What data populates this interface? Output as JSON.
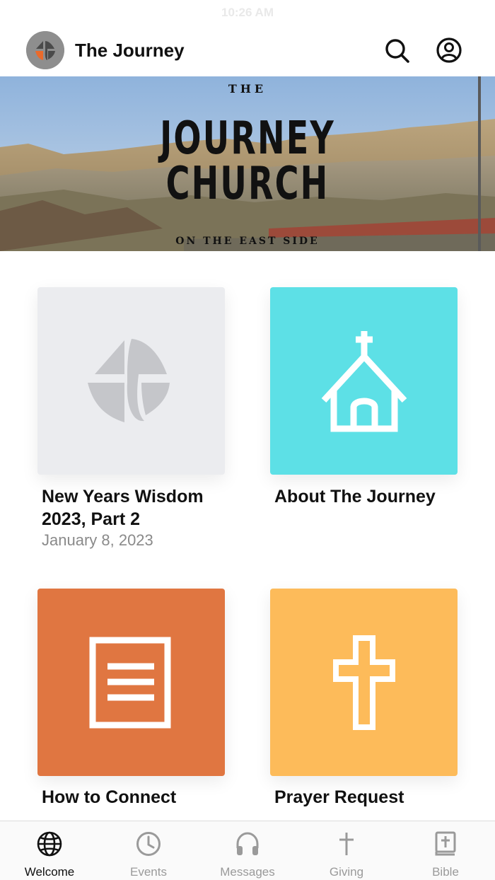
{
  "status": {
    "time": "10:26 AM"
  },
  "header": {
    "title": "The Journey"
  },
  "hero": {
    "line_top": "THE",
    "line_main_1": "JOURNEY",
    "line_main_2": "CHURCH",
    "line_bottom": "ON THE EAST SIDE"
  },
  "tiles": [
    {
      "title": "New Years Wisdom 2023, Part 2",
      "date": "January 8, 2023",
      "icon": "church-logo-icon",
      "color": "#ebecef"
    },
    {
      "title": "About The Journey",
      "icon": "chapel-icon",
      "color": "#5de0e6"
    },
    {
      "title": "How to Connect",
      "icon": "document-icon",
      "color": "#e07641"
    },
    {
      "title": "Prayer Request",
      "icon": "cross-icon",
      "color": "#fdbb5a"
    }
  ],
  "tabs": [
    {
      "label": "Welcome",
      "icon": "globe-icon",
      "active": true
    },
    {
      "label": "Events",
      "icon": "clock-icon",
      "active": false
    },
    {
      "label": "Messages",
      "icon": "headphones-icon",
      "active": false
    },
    {
      "label": "Giving",
      "icon": "cross-icon",
      "active": false
    },
    {
      "label": "Bible",
      "icon": "bible-icon",
      "active": false
    }
  ]
}
